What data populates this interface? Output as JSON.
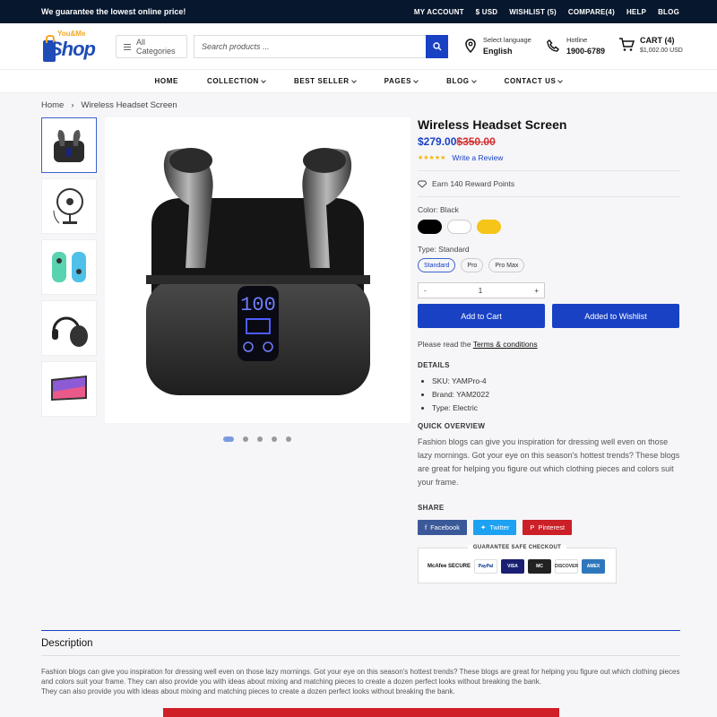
{
  "topbar": {
    "promo": "We guarantee the lowest online price!",
    "links": [
      "MY ACCOUNT",
      "$ USD",
      "WISHLIST (5)",
      "COMPARE(4)",
      "HELP",
      "BLOG"
    ]
  },
  "header": {
    "logo_top": "You&Me",
    "logo_main": "Shop",
    "categories_label": "All Categories",
    "search_placeholder": "Search products ...",
    "lang_small": "Select language",
    "lang_value": "English",
    "hotline_small": "Hotline",
    "hotline_value": "1900-6789",
    "cart_label": "CART (4)",
    "cart_total": "$1,002.00 USD"
  },
  "nav": [
    "HOME",
    "COLLECTION",
    "BEST SELLER",
    "PAGES",
    "BLOG",
    "CONTACT US"
  ],
  "breadcrumb": {
    "home": "Home",
    "current": "Wireless Headset Screen"
  },
  "product": {
    "title": "Wireless Headset Screen",
    "price": "$279.00",
    "old_price": "$350.00",
    "stars": "★★★★★",
    "review_link": "Write a Review",
    "reward": "Earn 140 Reward Points",
    "color_label": "Color: Black",
    "colors": [
      "#000000",
      "#ffffff",
      "#f5c518"
    ],
    "type_label": "Type: Standard",
    "types": [
      "Standard",
      "Pro",
      "Pro Max"
    ],
    "qty_minus": "-",
    "qty_value": "1",
    "qty_plus": "+",
    "add_to_cart": "Add to Cart",
    "add_to_wishlist": "Added to Wishlist",
    "terms_prefix": "Please read the",
    "terms_link": "Terms & conditions",
    "details_heading": "DETAILS",
    "details": [
      "SKU: YAMPro-4",
      "Brand: YAM2022",
      "Type: Electric"
    ],
    "overview_heading": "QUICK OVERVIEW",
    "overview": "Fashion blogs can give you inspiration for dressing well even on those lazy mornings. Got your eye on this season's hottest trends? These blogs are great for helping you figure out which clothing pieces and colors suit your frame.",
    "share_heading": "SHARE",
    "share": [
      "Facebook",
      "Twitter",
      "Pinterest"
    ],
    "checkout_title": "GUARANTEE SAFE CHECKOUT",
    "checkout_cards": [
      "McAfee SECURE",
      "PayPal",
      "VISA",
      "MC",
      "DISCOVER",
      "AMEX"
    ]
  },
  "description": {
    "title": "Description",
    "text1": "Fashion blogs can give you inspiration for dressing well even on those lazy mornings. Got your eye on this season's hottest trends? These blogs are great for helping you figure out which clothing pieces and colors suit your frame. They can also provide you with ideas about mixing and matching pieces to create a dozen perfect looks without breaking the bank.",
    "text2": "They can also provide you with ideas about mixing and matching pieces to create a dozen perfect looks without breaking the bank."
  }
}
